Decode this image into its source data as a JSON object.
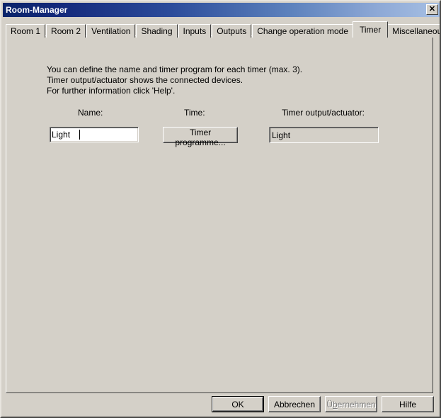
{
  "window": {
    "title": "Room-Manager",
    "close_icon": "close-icon",
    "close_glyph": "✕",
    "face_color": "#d4d0c8",
    "titlebar_start_color": "#0a246a",
    "titlebar_end_color": "#a6bfe3"
  },
  "tabs": [
    {
      "label": "Room 1",
      "active": false
    },
    {
      "label": "Room 2",
      "active": false
    },
    {
      "label": "Ventilation",
      "active": false
    },
    {
      "label": "Shading",
      "active": false
    },
    {
      "label": "Inputs",
      "active": false
    },
    {
      "label": "Outputs",
      "active": false
    },
    {
      "label": "Change operation mode",
      "active": false
    },
    {
      "label": "Timer",
      "active": true
    },
    {
      "label": "Miscellaneous",
      "active": false
    }
  ],
  "page": {
    "description_line1": "You can define the name and timer program for each timer (max. 3).",
    "description_line2": "Timer output/actuator shows the connected devices.",
    "description_line3": "For further information click 'Help'.",
    "columns": {
      "name": "Name:",
      "time": "Time:",
      "output": "Timer output/actuator:"
    },
    "row": {
      "name_value": "Light ",
      "name_placeholder": "",
      "time_button_label": "Timer programme...",
      "output_value": "Light"
    }
  },
  "footer": {
    "ok_label": "OK",
    "cancel_label": "Abbrechen",
    "apply_label_before": "Ü",
    "apply_label_accel": "b",
    "apply_label_after": "ernehmen",
    "apply_label": "Übernehmen",
    "apply_enabled": false,
    "help_label": "Hilfe"
  }
}
